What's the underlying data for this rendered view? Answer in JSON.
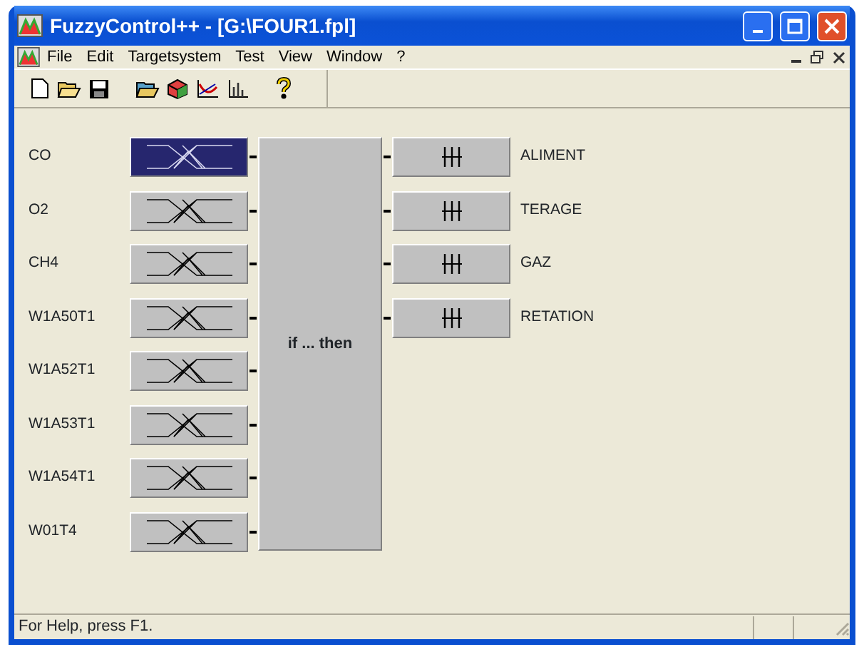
{
  "window": {
    "title": "FuzzyControl++ - [G:\\FOUR1.fpl]"
  },
  "menu": [
    {
      "label": "File"
    },
    {
      "label": "Edit"
    },
    {
      "label": "Targetsystem"
    },
    {
      "label": "Test"
    },
    {
      "label": "View"
    },
    {
      "label": "Window"
    },
    {
      "label": "?"
    }
  ],
  "inputs": [
    {
      "label": "CO",
      "selected": true
    },
    {
      "label": "O2",
      "selected": false
    },
    {
      "label": "CH4",
      "selected": false
    },
    {
      "label": "W1A50T1",
      "selected": false
    },
    {
      "label": "W1A52T1",
      "selected": false
    },
    {
      "label": "W1A53T1",
      "selected": false
    },
    {
      "label": "W1A54T1",
      "selected": false
    },
    {
      "label": "W01T4",
      "selected": false
    }
  ],
  "rule_block": {
    "label": "if ... then"
  },
  "outputs": [
    {
      "label": "ALIMENT"
    },
    {
      "label": "TERAGE"
    },
    {
      "label": "GAZ"
    },
    {
      "label": "RETATION"
    }
  ],
  "status_bar": {
    "text": "For Help, press F1."
  }
}
